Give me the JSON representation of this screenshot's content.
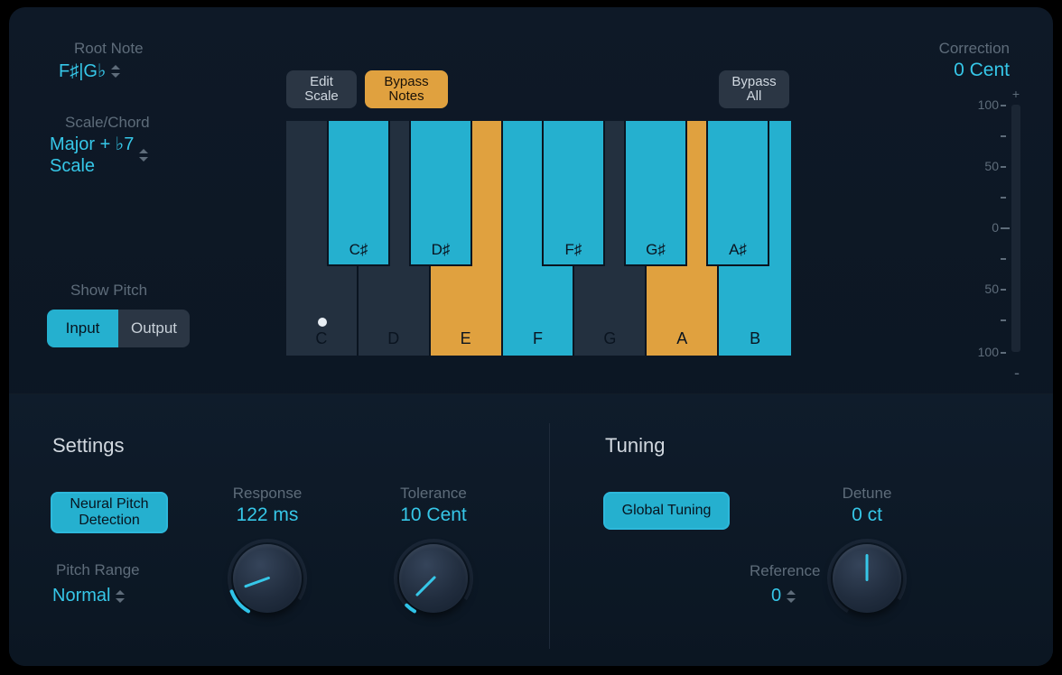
{
  "root_note": {
    "label": "Root Note",
    "value": "F♯|G♭"
  },
  "scale": {
    "label": "Scale/Chord",
    "value_line1": "Major + ♭7",
    "value_line2": "Scale"
  },
  "show_pitch": {
    "label": "Show Pitch",
    "input": "Input",
    "output": "Output"
  },
  "buttons": {
    "edit_scale": "Edit\nScale",
    "bypass_notes": "Bypass\nNotes",
    "bypass_all": "Bypass\nAll"
  },
  "keyboard": {
    "white": [
      {
        "name": "C",
        "state": "off",
        "dot": true
      },
      {
        "name": "D",
        "state": "off"
      },
      {
        "name": "E",
        "state": "orange"
      },
      {
        "name": "F",
        "state": "cyan"
      },
      {
        "name": "G",
        "state": "off"
      },
      {
        "name": "A",
        "state": "orange"
      },
      {
        "name": "B",
        "state": "cyan"
      }
    ],
    "black": [
      {
        "name": "C♯",
        "state": "cyan",
        "pos": 45
      },
      {
        "name": "D♯",
        "state": "cyan",
        "pos": 136
      },
      {
        "name": "F♯",
        "state": "cyan",
        "pos": 283
      },
      {
        "name": "G♯",
        "state": "cyan",
        "pos": 374
      },
      {
        "name": "A♯",
        "state": "cyan",
        "pos": 465
      }
    ]
  },
  "correction": {
    "label": "Correction",
    "value": "0 Cent",
    "scale": [
      "100",
      "50",
      "0",
      "50",
      "100"
    ],
    "plus": "+",
    "minus": "-"
  },
  "settings": {
    "title": "Settings",
    "neural": "Neural Pitch\nDetection",
    "pitch_range": {
      "label": "Pitch Range",
      "value": "Normal"
    },
    "response": {
      "label": "Response",
      "value": "122 ms",
      "angle": -110
    },
    "tolerance": {
      "label": "Tolerance",
      "value": "10 Cent",
      "angle": -135
    }
  },
  "tuning": {
    "title": "Tuning",
    "global": "Global Tuning",
    "reference": {
      "label": "Reference",
      "value": "0"
    },
    "detune": {
      "label": "Detune",
      "value": "0 ct",
      "angle": 0
    }
  }
}
